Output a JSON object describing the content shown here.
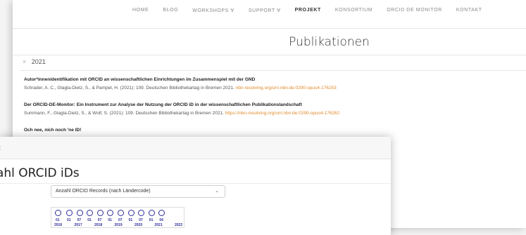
{
  "nav": {
    "items": [
      "HOME",
      "BLOG",
      "WORKSHOPS ∀",
      "SUPPORT ∀",
      "PROJEKT",
      "KONSORTIUM",
      "ORCID DE MONITOR",
      "KONTAKT"
    ],
    "active_index": 4
  },
  "page": {
    "title": "Publikationen"
  },
  "filter": {
    "close": "×",
    "value": "2021"
  },
  "publications": [
    {
      "title": "Autor*innenidentifikation mit ORCID an wissenschaftlichen Einrichtungen im Zusammenspiel mit der GND",
      "meta": "Schrader, A. C., Glagla-Dietz, S., & Pampel, H. (2021): 109. Deutschen Bibliothekartag in Bremen 2021.",
      "link": "nbn-resolving.org/urn:nbn:de:0290-opus4-176253"
    },
    {
      "title": "Der ORCID-DE-Monitor: Ein Instrument zur Analyse der Nutzung der ORCID iD in der wissenschaftlichen Publikationslandschaft",
      "meta": "Summann, F., Glagla-Dietz, S., & Wolf, S. (2021): 109. Deutschen Bibliothekartag in Bremen 2021.",
      "link": "https://nbn-resolving.org/urn:nbn:de:0290-opus4-176262"
    },
    {
      "title": "Och nee, nich noch 'ne ID!",
      "meta": "",
      "link": ""
    }
  ],
  "front": {
    "chevron": "‹",
    "title": "zahl ORCID iDs",
    "select_value": "Anzahl ORCID Records (nach Ländercode)",
    "select_caret": "⌄",
    "timeline": {
      "labels_top": [
        "01",
        "01",
        "07",
        "01",
        "07",
        "01",
        "07",
        "01",
        "07",
        "01",
        "04"
      ],
      "labels_bottom": [
        "2016",
        "2017",
        "2018",
        "2019",
        "2020",
        "2021",
        "2022"
      ],
      "accent": "#2c2c9a"
    }
  },
  "colors": {
    "link": "#e08a2a",
    "text": "#222222",
    "nav": "#8a8a8a"
  }
}
